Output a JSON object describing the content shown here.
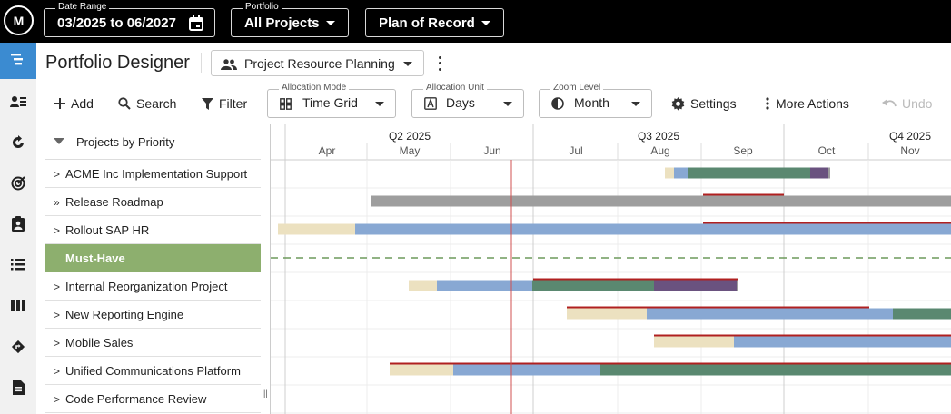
{
  "top_bar": {
    "logo_text": "M",
    "date_range": {
      "label": "Date Range",
      "value": "03/2025 to 06/2027"
    },
    "portfolio": {
      "label": "Portfolio",
      "value": "All Projects"
    },
    "plan": {
      "value": "Plan of Record"
    }
  },
  "side_nav": {
    "items": [
      {
        "icon": "gantt-icon",
        "active": true
      },
      {
        "icon": "resource-list-icon",
        "active": false
      },
      {
        "icon": "cycle-icon",
        "active": false
      },
      {
        "icon": "target-icon",
        "active": false
      },
      {
        "icon": "clipboard-user-icon",
        "active": false
      },
      {
        "icon": "list-icon",
        "active": false
      },
      {
        "icon": "columns-icon",
        "active": false
      },
      {
        "icon": "route-icon",
        "active": false
      },
      {
        "icon": "document-icon",
        "active": false
      }
    ]
  },
  "header": {
    "title": "Portfolio Designer",
    "view_select": "Project Resource Planning"
  },
  "toolbar": {
    "add": "Add",
    "search": "Search",
    "filter": "Filter",
    "allocation_mode": {
      "label": "Allocation Mode",
      "value": "Time Grid"
    },
    "allocation_unit": {
      "label": "Allocation Unit",
      "value": "Days"
    },
    "zoom_level": {
      "label": "Zoom Level",
      "value": "Month"
    },
    "settings": "Settings",
    "more_actions": "More Actions",
    "undo": "Undo"
  },
  "project_list": {
    "header": "Projects by Priority",
    "rows": [
      {
        "label": "ACME Inc Implementation Support",
        "chevron": ">"
      },
      {
        "label": "Release Roadmap",
        "chevron": "»"
      },
      {
        "label": "Rollout SAP HR",
        "chevron": ">"
      },
      {
        "label": "Must-Have",
        "group": true
      },
      {
        "label": "Internal Reorganization Project",
        "chevron": ">"
      },
      {
        "label": "New Reporting Engine",
        "chevron": ">"
      },
      {
        "label": "Mobile Sales",
        "chevron": ">"
      },
      {
        "label": "Unified Communications Platform",
        "chevron": ">"
      },
      {
        "label": "Code Performance Review",
        "chevron": ">"
      }
    ]
  },
  "timeline": {
    "quarters": [
      "Q2 2025",
      "Q3 2025",
      "Q4 2025"
    ],
    "months": [
      "Apr",
      "May",
      "Jun",
      "Jul",
      "Aug",
      "Sep",
      "Oct",
      "Nov"
    ],
    "today": "Jun 2025",
    "colors": {
      "phase_tan": "#ece1c0",
      "phase_blue": "#88a8d3",
      "phase_green": "#5a8870",
      "phase_purple": "#6a527f",
      "phase_gray": "#9e9e9e",
      "today_line": "#d05050",
      "group_dash": "#6d9a5c",
      "deadline_red": "#b02020"
    }
  }
}
